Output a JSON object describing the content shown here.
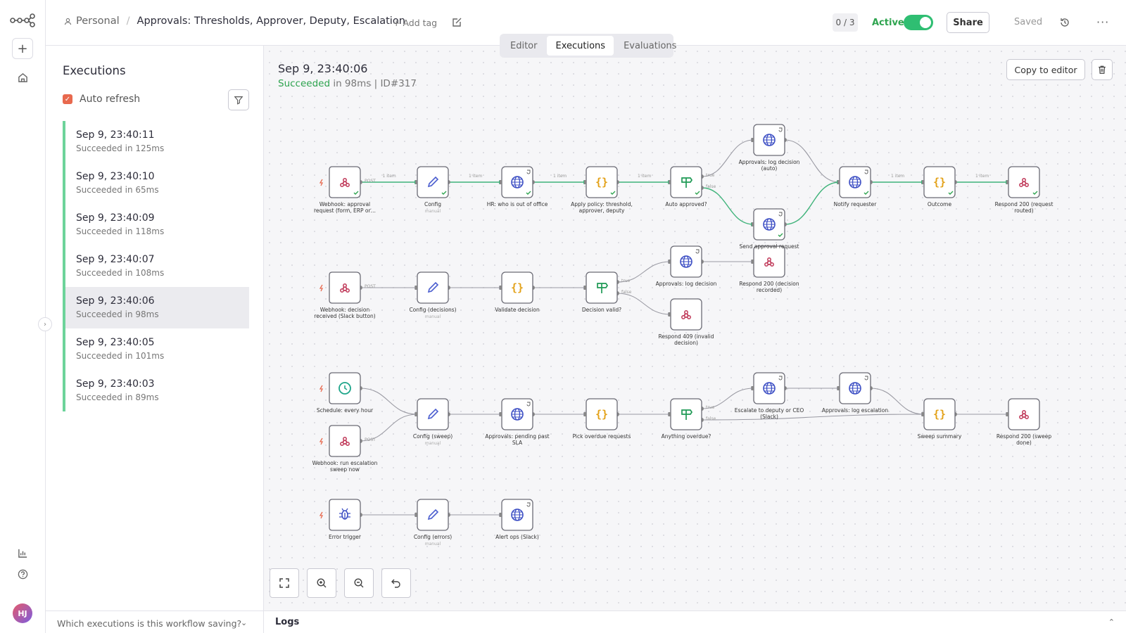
{
  "header": {
    "project": "Personal",
    "workflow_name": "Approvals: Thresholds, Approver, Deputy, Escalation",
    "add_tag": "+ Add tag",
    "counter": "0 / 3",
    "active_label": "Active",
    "share_label": "Share",
    "saved_label": "Saved",
    "more": "···"
  },
  "rail": {
    "avatar_initials": "HJ"
  },
  "tabs": [
    "Editor",
    "Executions",
    "Evaluations"
  ],
  "executions": {
    "title": "Executions",
    "auto_refresh": "Auto refresh",
    "items": [
      {
        "time": "Sep 9, 23:40:11",
        "status": "Succeeded in 125ms"
      },
      {
        "time": "Sep 9, 23:40:10",
        "status": "Succeeded in 65ms"
      },
      {
        "time": "Sep 9, 23:40:09",
        "status": "Succeeded in 118ms"
      },
      {
        "time": "Sep 9, 23:40:07",
        "status": "Succeeded in 108ms"
      },
      {
        "time": "Sep 9, 23:40:06",
        "status": "Succeeded in 98ms"
      },
      {
        "time": "Sep 9, 23:40:05",
        "status": "Succeeded in 101ms"
      },
      {
        "time": "Sep 9, 23:40:03",
        "status": "Succeeded in 89ms"
      }
    ],
    "saving_question": "Which executions is this workflow saving?"
  },
  "run": {
    "title": "Sep 9, 23:40:06",
    "status": "Succeeded",
    "duration": "in 98ms",
    "separator": "|",
    "id": "ID#317",
    "copy_label": "Copy to editor"
  },
  "logs_label": "Logs",
  "colors": {
    "accent": "#e8694e",
    "success": "#2ea44f",
    "toggle": "#2fbe72",
    "exec_bar": "#6dd39a"
  },
  "graph": {
    "nodes": [
      {
        "id": "wh1",
        "label": "Webhook: approval request (form, ERP or…",
        "icon": "webhook-icon",
        "trigger": true
      },
      {
        "id": "cfg1",
        "label": "Config",
        "sub": "manual",
        "icon": "pencil-icon"
      },
      {
        "id": "hr",
        "label": "HR: who is out of office",
        "icon": "globe-icon"
      },
      {
        "id": "pol",
        "label": "Apply policy: threshold, approver, deputy",
        "icon": "code-icon"
      },
      {
        "id": "auto",
        "label": "Auto approved?",
        "icon": "switch-icon"
      },
      {
        "id": "logauto",
        "label": "Approvals: log decision (auto)",
        "icon": "globe-icon"
      },
      {
        "id": "send",
        "label": "Send approval request",
        "icon": "globe-icon"
      },
      {
        "id": "notify",
        "label": "Notify requester",
        "icon": "globe-icon"
      },
      {
        "id": "outcome",
        "label": "Outcome",
        "icon": "code-icon"
      },
      {
        "id": "r200a",
        "label": "Respond 200 (request routed)",
        "icon": "webhook-icon"
      },
      {
        "id": "wh2",
        "label": "Webhook: decision received (Slack button)",
        "icon": "webhook-icon",
        "trigger": true
      },
      {
        "id": "cfg2",
        "label": "Config (decisions)",
        "sub": "manual",
        "icon": "pencil-icon"
      },
      {
        "id": "val",
        "label": "Validate decision",
        "icon": "code-icon"
      },
      {
        "id": "dv",
        "label": "Decision valid?",
        "icon": "switch-icon"
      },
      {
        "id": "logdec",
        "label": "Approvals: log decision",
        "icon": "globe-icon"
      },
      {
        "id": "r200b",
        "label": "Respond 200 (decision recorded)",
        "icon": "webhook-icon"
      },
      {
        "id": "r409",
        "label": "Respond 409 (invalid decision)",
        "icon": "webhook-icon"
      },
      {
        "id": "sched",
        "label": "Schedule: every hour",
        "icon": "clock-icon",
        "trigger": true
      },
      {
        "id": "wh3",
        "label": "Webhook: run escalation sweep now",
        "icon": "webhook-icon",
        "trigger": true
      },
      {
        "id": "cfg3",
        "label": "Config (sweep)",
        "sub": "manual",
        "icon": "pencil-icon"
      },
      {
        "id": "pend",
        "label": "Approvals: pending past SLA",
        "icon": "globe-icon"
      },
      {
        "id": "pick",
        "label": "Pick overdue requests",
        "icon": "code-icon"
      },
      {
        "id": "any",
        "label": "Anything overdue?",
        "icon": "switch-icon"
      },
      {
        "id": "esc",
        "label": "Escalate to deputy or CEO (Slack)",
        "icon": "globe-icon"
      },
      {
        "id": "logesc",
        "label": "Approvals: log escalation",
        "icon": "globe-icon"
      },
      {
        "id": "sweep",
        "label": "Sweep summary",
        "icon": "code-icon"
      },
      {
        "id": "r200c",
        "label": "Respond 200 (sweep done)",
        "icon": "webhook-icon"
      },
      {
        "id": "err",
        "label": "Error trigger",
        "icon": "bug-icon",
        "trigger": true
      },
      {
        "id": "cfg4",
        "label": "Config (errors)",
        "sub": "manual",
        "icon": "pencil-icon"
      },
      {
        "id": "alert",
        "label": "Alert ops (Slack)",
        "icon": "globe-icon"
      }
    ],
    "edge_labels": {
      "items": "1 item",
      "post": "POST",
      "true": "true",
      "false": "false"
    }
  }
}
